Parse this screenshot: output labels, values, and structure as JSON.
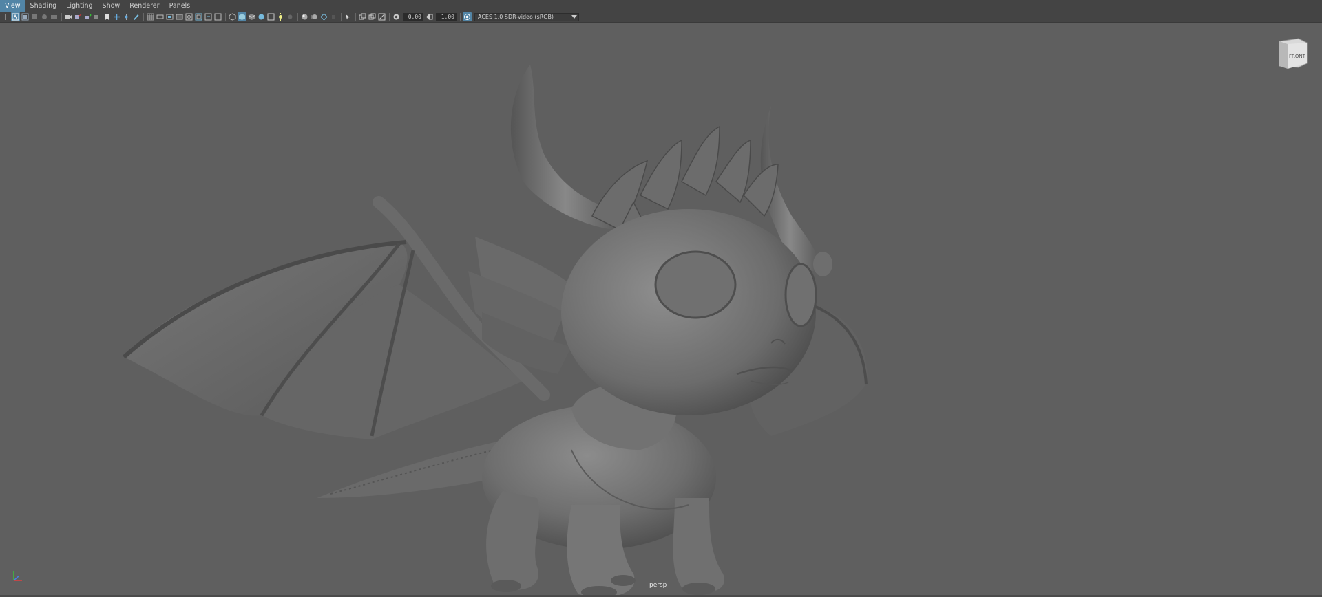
{
  "menubar": {
    "items": [
      {
        "label": "View",
        "active": true
      },
      {
        "label": "Shading",
        "active": false
      },
      {
        "label": "Lighting",
        "active": false
      },
      {
        "label": "Show",
        "active": false
      },
      {
        "label": "Renderer",
        "active": false
      },
      {
        "label": "Panels",
        "active": false
      }
    ]
  },
  "toolbar": {
    "exposure_value": "0.00",
    "gamma_value": "1.00",
    "color_management": "ACES 1.0 SDR-video (sRGB)"
  },
  "viewport": {
    "camera": "persp",
    "viewcube_face": "FRONT"
  },
  "colors": {
    "menubar_bg": "#444444",
    "active_highlight": "#5285a6",
    "viewport_bg": "#5f5f5f"
  }
}
